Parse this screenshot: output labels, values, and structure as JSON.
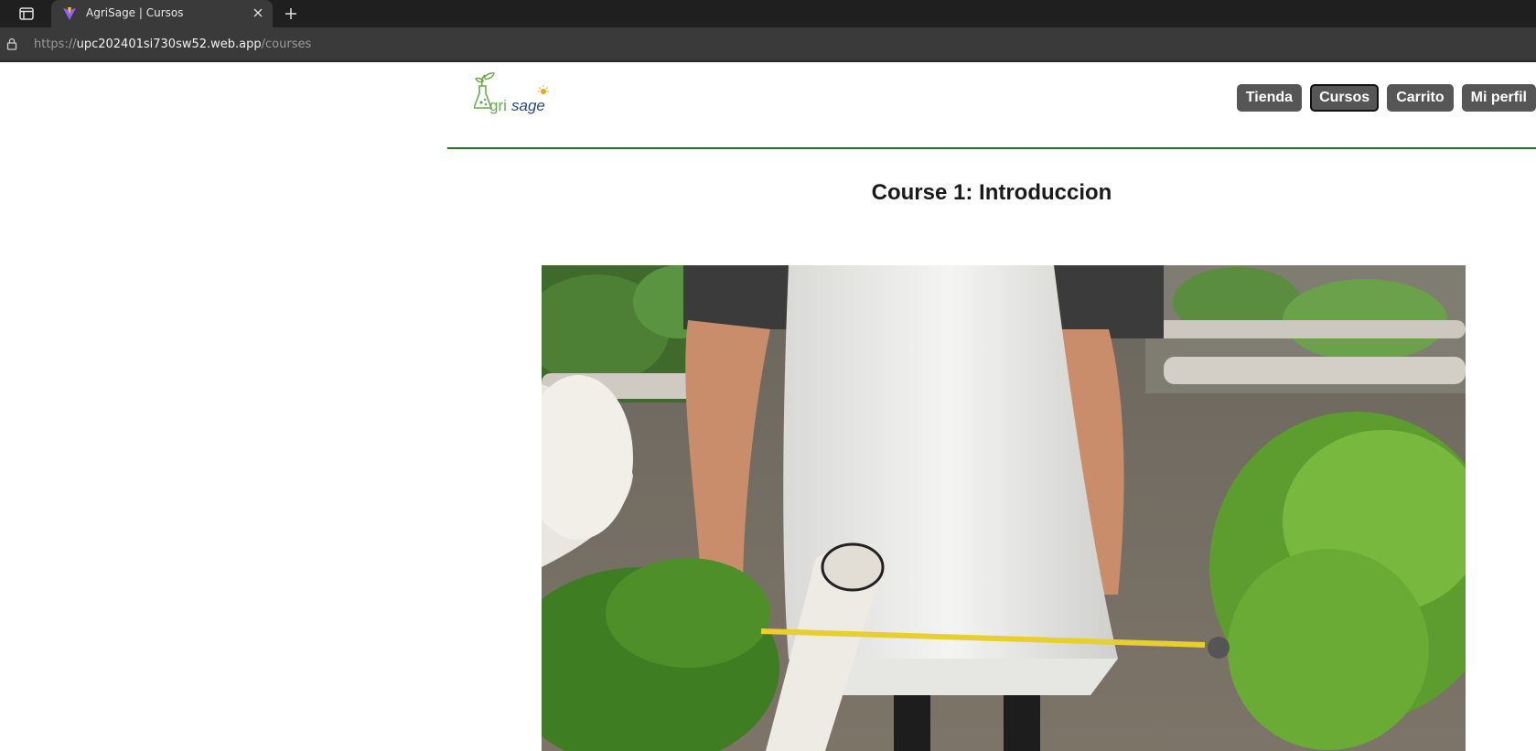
{
  "browser": {
    "tab_title": "AgriSage | Cursos",
    "url_scheme": "https://",
    "url_host": "upc202401si730sw52.web.app",
    "url_path": "/courses"
  },
  "header": {
    "logo_text": "agrisage",
    "nav": [
      {
        "label": "Tienda",
        "active": false
      },
      {
        "label": "Cursos",
        "active": true
      },
      {
        "label": "Carrito",
        "active": false
      },
      {
        "label": "Mi perfil",
        "active": false
      }
    ]
  },
  "course": {
    "title": "Course 1: Introduccion"
  },
  "colors": {
    "accent_green": "#1f7a1f",
    "nav_button": "#565656",
    "chrome_dark": "#1f1f1f",
    "chrome_mid": "#3a3a3a"
  }
}
